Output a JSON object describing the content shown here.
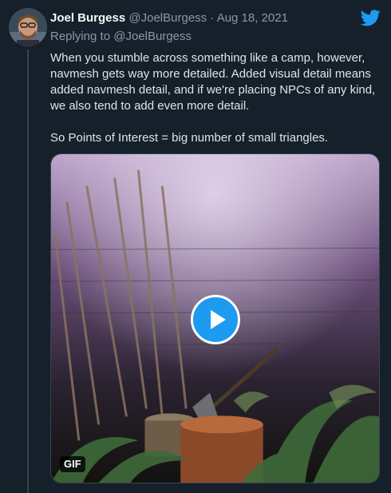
{
  "tweet": {
    "author_name": "Joel Burgess",
    "handle": "@JoelBurgess",
    "separator": " · ",
    "date": "Aug 18, 2021",
    "replying_label": "Replying to ",
    "replying_handle": "@JoelBurgess",
    "text_lines": [
      "When you stumble across something like a camp, however,",
      "navmesh gets way more detailed.  Added visual detail means",
      "added navmesh detail, and if we're placing NPCs of any kind,",
      "we also tend to add even more detail."
    ],
    "text_line_last": "So Points of Interest = big number of small triangles.",
    "media": {
      "badge": "GIF"
    },
    "colors": {
      "accent": "#1d9bf0",
      "background": "#15202b"
    },
    "icons": [
      "avatar",
      "twitter-bird-icon",
      "play-icon"
    ]
  }
}
